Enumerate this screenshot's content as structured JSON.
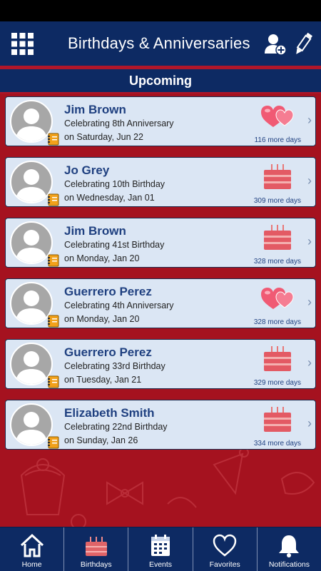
{
  "app_bar": {
    "title": "Birthdays & Anniversaries"
  },
  "section": {
    "title": "Upcoming"
  },
  "events": [
    {
      "name": "Jim Brown",
      "celebrating": "Celebrating 8th Anniversary",
      "date": "on Saturday, Jun 22",
      "days": "116 more days",
      "icon": "hearts-icon"
    },
    {
      "name": "Jo Grey",
      "celebrating": "Celebrating 10th Birthday",
      "date": "on Wednesday, Jan 01",
      "days": "309 more days",
      "icon": "cake-icon"
    },
    {
      "name": "Jim Brown",
      "celebrating": "Celebrating 41st Birthday",
      "date": "on Monday, Jan 20",
      "days": "328 more days",
      "icon": "cake-icon"
    },
    {
      "name": "Guerrero Perez",
      "celebrating": "Celebrating 4th Anniversary",
      "date": "on Monday, Jan 20",
      "days": "328 more days",
      "icon": "hearts-icon"
    },
    {
      "name": "Guerrero Perez",
      "celebrating": "Celebrating 33rd Birthday",
      "date": "on Tuesday, Jan 21",
      "days": "329 more days",
      "icon": "cake-icon"
    },
    {
      "name": "Elizabeth Smith",
      "celebrating": "Celebrating 22nd Birthday",
      "date": "on Sunday, Jan 26",
      "days": "334 more days",
      "icon": "cake-icon"
    }
  ],
  "chevron": "›",
  "nav": [
    {
      "label": "Home",
      "icon": "home-icon"
    },
    {
      "label": "Birthdays",
      "icon": "cake-icon"
    },
    {
      "label": "Events",
      "icon": "calendar-icon"
    },
    {
      "label": "Favorites",
      "icon": "heart-icon"
    },
    {
      "label": "Notifications",
      "icon": "bell-icon"
    }
  ],
  "colors": {
    "header": "#0d2a63",
    "background": "#a5121f",
    "card": "#dbe6f4",
    "accent": "#1f4080"
  }
}
